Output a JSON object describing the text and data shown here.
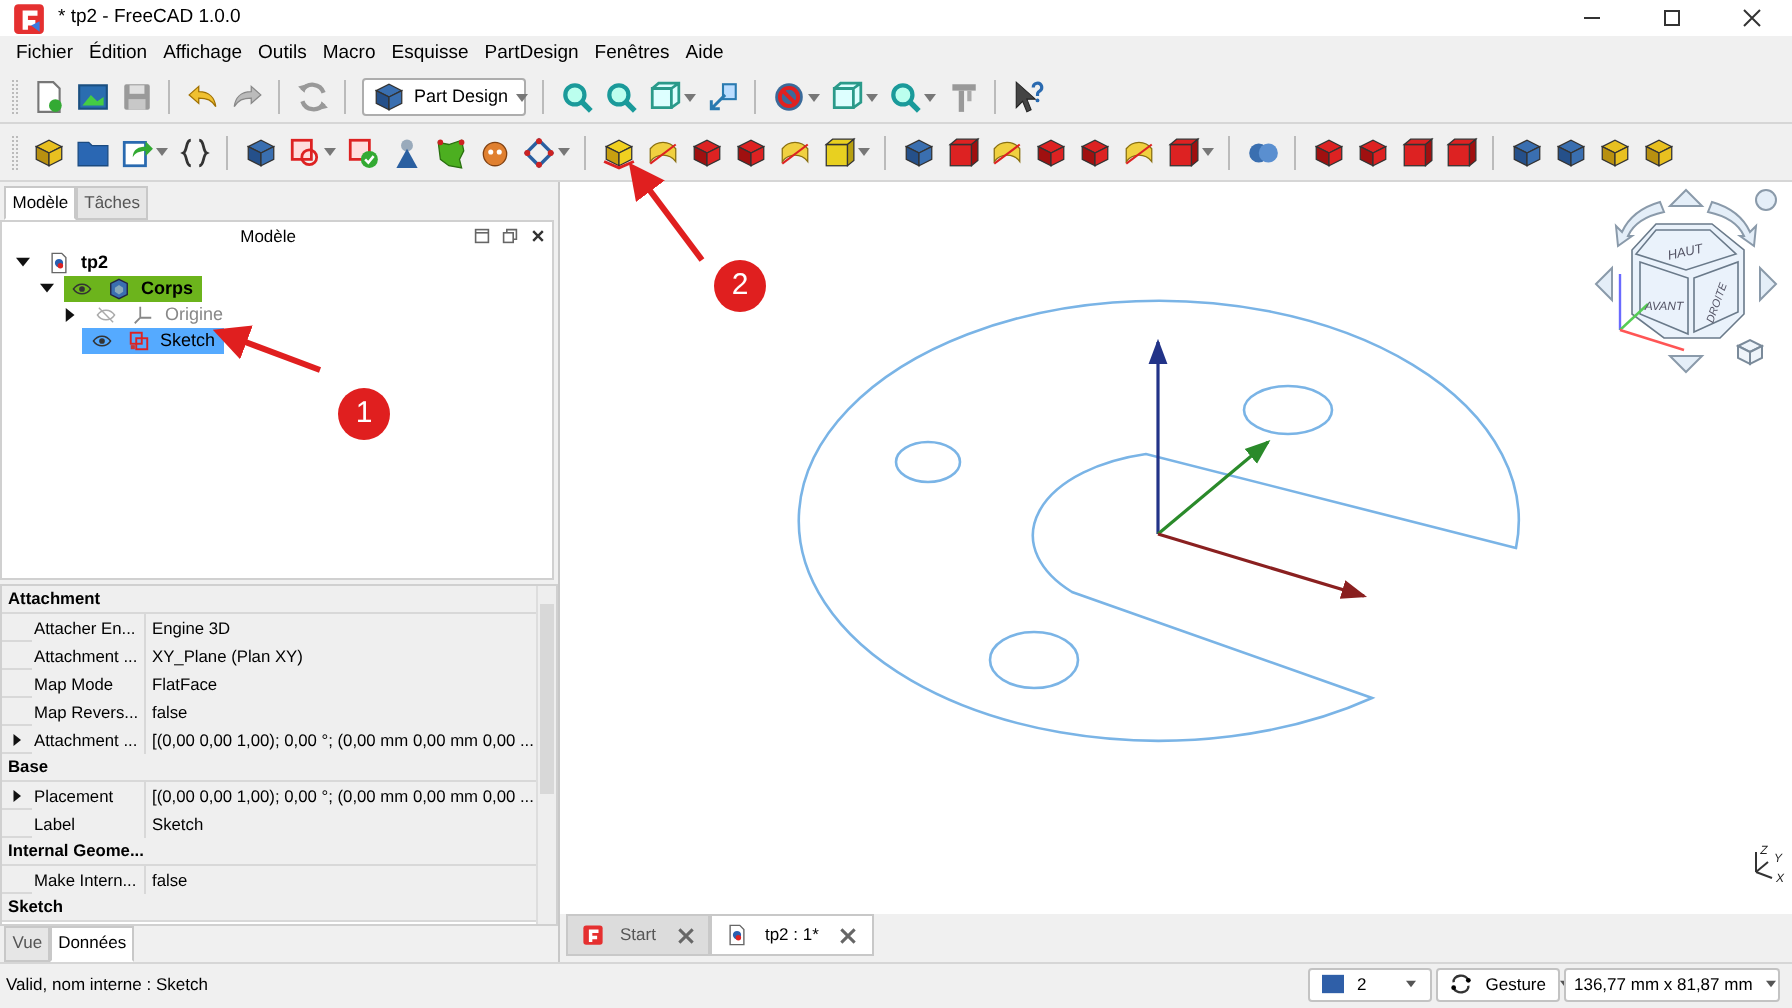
{
  "window": {
    "title": "* tp2 - FreeCAD 1.0.0"
  },
  "menu": [
    "Fichier",
    "Édition",
    "Affichage",
    "Outils",
    "Macro",
    "Esquisse",
    "PartDesign",
    "Fenêtres",
    "Aide"
  ],
  "toolbar": {
    "workbench": "Part Design"
  },
  "model_panel": {
    "tabs": [
      {
        "label": "Modèle",
        "selected": true
      },
      {
        "label": "Tâches",
        "selected": false
      }
    ],
    "title": "Modèle",
    "tree": [
      {
        "label": "tp2",
        "kind": "document",
        "expanded": true,
        "active": false,
        "selected": false,
        "children": [
          {
            "label": "Corps",
            "kind": "body",
            "expanded": true,
            "visible": true,
            "active": true,
            "selected": false,
            "children": [
              {
                "label": "Origine",
                "kind": "origin",
                "expanded": false,
                "visible": false,
                "active": false,
                "selected": false
              },
              {
                "label": "Sketch",
                "kind": "sketch",
                "visible": true,
                "active": false,
                "selected": true
              }
            ]
          }
        ]
      }
    ]
  },
  "properties": {
    "groups": [
      {
        "title": "Attachment",
        "rows": [
          {
            "name": "Attacher En...",
            "value": "Engine 3D",
            "expandable": false
          },
          {
            "name": "Attachment ...",
            "value": "XY_Plane (Plan XY)",
            "expandable": false
          },
          {
            "name": "Map Mode",
            "value": "FlatFace",
            "expandable": false
          },
          {
            "name": "Map Revers...",
            "value": "false",
            "expandable": false
          },
          {
            "name": "Attachment ...",
            "value": "[(0,00 0,00 1,00); 0,00 °; (0,00 mm  0,00 mm  0,00 ...",
            "expandable": true
          }
        ]
      },
      {
        "title": "Base",
        "rows": [
          {
            "name": "Placement",
            "value": "[(0,00 0,00 1,00); 0,00 °; (0,00 mm  0,00 mm  0,00 ...",
            "expandable": true
          },
          {
            "name": "Label",
            "value": "Sketch",
            "expandable": false
          }
        ]
      },
      {
        "title": "Internal Geome...",
        "rows": [
          {
            "name": "Make Intern...",
            "value": "false",
            "expandable": false
          }
        ]
      },
      {
        "title": "Sketch"
      }
    ],
    "tabs": [
      {
        "label": "Vue",
        "selected": false
      },
      {
        "label": "Données",
        "selected": true
      }
    ]
  },
  "viewport": {
    "navigation_cube": {
      "top": "HAUT",
      "front": "AVANT",
      "right": "DROITE"
    },
    "axis_labels": [
      "Z",
      "Y",
      "X"
    ]
  },
  "document_tabs": [
    {
      "label": "Start",
      "kind": "start",
      "selected": false
    },
    {
      "label": "tp2 : 1*",
      "kind": "document",
      "selected": true
    }
  ],
  "annotations": [
    {
      "number": "1"
    },
    {
      "number": "2"
    }
  ],
  "status_bar": {
    "message": "Valid, nom interne : Sketch",
    "draw_style": "2",
    "navigation": "Gesture",
    "dimensions": "136,77 mm x 81,87 mm"
  }
}
